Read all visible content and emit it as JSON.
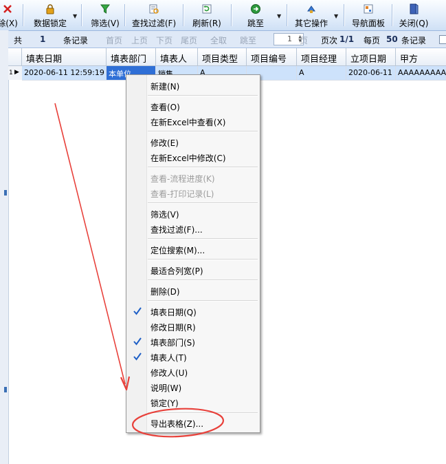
{
  "toolbar": {
    "items": [
      {
        "label": "除(X)",
        "icon": "delete-icon"
      },
      {
        "label": "数据锁定",
        "icon": "lock-icon"
      },
      {
        "label": "筛选(V)",
        "icon": "filter-icon"
      },
      {
        "label": "查找过滤(F)",
        "icon": "find-filter-icon"
      },
      {
        "label": "刷新(R)",
        "icon": "refresh-icon"
      },
      {
        "label": "跳至",
        "icon": "goto-icon"
      },
      {
        "label": "其它操作",
        "icon": "other-actions-icon"
      },
      {
        "label": "导航面板",
        "icon": "nav-panel-icon"
      },
      {
        "label": "关闭(Q)",
        "icon": "close-icon"
      }
    ]
  },
  "navbar": {
    "total_prefix": "共",
    "total_count": "1",
    "total_suffix": "条记录",
    "first": "首页",
    "prev": "上页",
    "next": "下页",
    "last": "尾页",
    "all": "全取",
    "jump": "跳至",
    "page_value": "1",
    "page_unit": "页",
    "page_no_label": "页次",
    "page_no": "1/1",
    "per_page_label": "每页",
    "per_page": "50",
    "per_page_suffix": "条记录"
  },
  "grid": {
    "columns": [
      "填表日期",
      "填表部门",
      "填表人",
      "项目类型",
      "项目编号",
      "项目经理",
      "立项日期",
      "甲方"
    ],
    "rows": [
      {
        "index": "1",
        "cells": [
          "2020-06-11 12:59:19",
          "本单位",
          "销售",
          "A",
          "",
          "A",
          "2020-06-11",
          "AAAAAAAAAAA"
        ]
      }
    ]
  },
  "context_menu": {
    "items": [
      {
        "label": "新建(N)"
      },
      {
        "label": "查看(O)"
      },
      {
        "label": "在新Excel中查看(X)"
      },
      {
        "label": "修改(E)"
      },
      {
        "label": "在新Excel中修改(C)"
      },
      {
        "label": "查看-流程进度(K)"
      },
      {
        "label": "查看-打印记录(L)"
      },
      {
        "label": "筛选(V)"
      },
      {
        "label": "查找过滤(F)..."
      },
      {
        "label": "定位搜索(M)..."
      },
      {
        "label": "最适合列宽(P)"
      },
      {
        "label": "删除(D)"
      },
      {
        "label": "填表日期(Q)",
        "checked": true
      },
      {
        "label": "修改日期(R)",
        "checked": false
      },
      {
        "label": "填表部门(S)",
        "checked": true
      },
      {
        "label": "填表人(T)",
        "checked": true
      },
      {
        "label": "修改人(U)",
        "checked": false
      },
      {
        "label": "说明(W)",
        "checked": false
      },
      {
        "label": "锁定(Y)",
        "checked": false
      },
      {
        "label": "导出表格(Z)..."
      }
    ]
  },
  "colors": {
    "accent": "#2f6fd6",
    "annotation": "#e8403a",
    "check": "#1e5fc6"
  }
}
